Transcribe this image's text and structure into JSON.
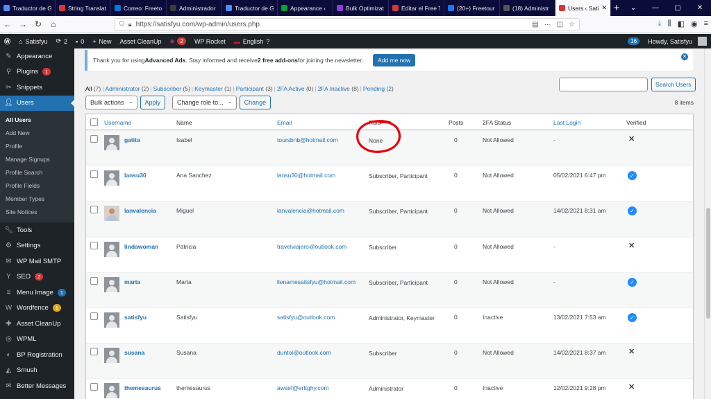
{
  "browser": {
    "tabs": [
      {
        "label": "Traductor de G",
        "color": "#4f8df5",
        "active": false
      },
      {
        "label": "String Translat",
        "color": "#d63638",
        "active": false
      },
      {
        "label": "Correo: Freeto",
        "color": "#0078d4",
        "active": false
      },
      {
        "label": "Administrador",
        "color": "#3c3c3c",
        "active": false
      },
      {
        "label": "Traductor de G",
        "color": "#4f8df5",
        "active": false
      },
      {
        "label": "Appearance ‹",
        "color": "#00a32a",
        "active": false
      },
      {
        "label": "Bulk Optimizat",
        "color": "#8f3cd6",
        "active": false
      },
      {
        "label": "Editar el Free T",
        "color": "#d63638",
        "active": false
      },
      {
        "label": "(20+) Freetour",
        "color": "#1877f2",
        "active": false
      },
      {
        "label": "(18) Administr",
        "color": "#555555",
        "active": false
      },
      {
        "label": "Users ‹ Sati",
        "color": "#d63638",
        "active": true
      }
    ],
    "url": "https://satisfyu.com/wp-admin/users.php"
  },
  "adminbar": {
    "site": "Satisfyu",
    "updates": "2",
    "comments": "0",
    "new": "New",
    "asset_cleanup": "Asset CleanUp",
    "notifications": "2",
    "wp_rocket": "WP Rocket",
    "language": "English",
    "count": "16",
    "howdy": "Howdy, Satisfyu"
  },
  "sidebar": {
    "top_items": [
      {
        "label": "Appearance",
        "icon": "appearance-icon"
      },
      {
        "label": "Plugins",
        "icon": "plugins-icon",
        "badge": "1"
      },
      {
        "label": "Snippets",
        "icon": "snippets-icon"
      },
      {
        "label": "Users",
        "icon": "users-icon",
        "current": true
      }
    ],
    "submenu": [
      "All Users",
      "Add New",
      "Profile",
      "Manage Signups",
      "Profile Search",
      "Profile Fields",
      "Member Types",
      "Site Notices"
    ],
    "bottom_items": [
      {
        "label": "Tools",
        "icon": "tools-icon"
      },
      {
        "label": "Settings",
        "icon": "settings-icon"
      },
      {
        "label": "WP Mail SMTP",
        "icon": "mail-icon"
      },
      {
        "label": "SEO",
        "icon": "seo-icon",
        "badge": "2",
        "badge_color": "#d63638"
      },
      {
        "label": "Menu Image",
        "icon": "menu-image-icon",
        "badge": "1",
        "badge_color": "#2271b1"
      },
      {
        "label": "Wordfence",
        "icon": "wordfence-icon",
        "badge": "1",
        "badge_color": "#dba617"
      },
      {
        "label": "Asset CleanUp",
        "icon": "asset-cleanup-icon"
      },
      {
        "label": "WPML",
        "icon": "wpml-icon"
      },
      {
        "label": "BP Registration",
        "icon": "bp-registration-icon"
      },
      {
        "label": "Smush",
        "icon": "smush-icon"
      },
      {
        "label": "Better Messages",
        "icon": "better-messages-icon"
      }
    ]
  },
  "notice": {
    "text_before": "Thank you for using ",
    "brand": "Advanced Ads",
    "text_middle": ". Stay informed and receive ",
    "highlight": "2 free add-ons",
    "text_after": " for joining the newsletter.",
    "button": "Add me now"
  },
  "filters": [
    {
      "label": "All",
      "count": "(7)",
      "current": true
    },
    {
      "label": "Administrator",
      "count": "(2)"
    },
    {
      "label": "Subscriber",
      "count": "(5)"
    },
    {
      "label": "Keymaster",
      "count": "(1)"
    },
    {
      "label": "Participant",
      "count": "(3)"
    },
    {
      "label": "2FA Active",
      "count": "(0)"
    },
    {
      "label": "2FA Inactive",
      "count": "(8)"
    },
    {
      "label": "Pending",
      "count": "(2)"
    }
  ],
  "search_button": "Search Users",
  "bulk_actions": "Bulk actions",
  "apply": "Apply",
  "change_role": "Change role to...",
  "change": "Change",
  "item_count": "8 items",
  "columns": {
    "username": "Username",
    "name": "Name",
    "email": "Email",
    "role": "Role",
    "posts": "Posts",
    "twofa": "2FA Status",
    "last_login": "Last Login",
    "verified": "Verified"
  },
  "users": [
    {
      "username": "gatita",
      "name": "Isabel",
      "email": "toursbnb@hotmail.com",
      "role": "None",
      "posts": "0",
      "twofa": "Not Allowed",
      "last_login": "-",
      "verified": false,
      "avatar": "default"
    },
    {
      "username": "lansu30",
      "name": "Ana Sanchez",
      "email": "lansu30@hotmail.com",
      "role": "Subscriber, Participant",
      "posts": "0",
      "twofa": "Not Allowed",
      "last_login": "05/02/2021 6:47 pm",
      "verified": true,
      "avatar": "default"
    },
    {
      "username": "lanvalencia",
      "name": "Miguel",
      "email": "lanvalencia@hotmail.com",
      "role": "Subscriber, Participant",
      "posts": "0",
      "twofa": "Not Allowed",
      "last_login": "14/02/2021 8:31 am",
      "verified": true,
      "avatar": "photo"
    },
    {
      "username": "lindawoman",
      "name": "Patricia",
      "email": "travelviajero@outlook.com",
      "role": "Subscriber",
      "posts": "0",
      "twofa": "Not Allowed",
      "last_login": "-",
      "verified": false,
      "avatar": "default"
    },
    {
      "username": "marta",
      "name": "Marta",
      "email": "llenamesatisfyu@hotmail.com",
      "role": "Subscriber, Participant",
      "posts": "0",
      "twofa": "Not Allowed",
      "last_login": "-",
      "verified": true,
      "avatar": "default"
    },
    {
      "username": "satisfyu",
      "name": "Satisfyu",
      "email": "satisfyu@outlook.com",
      "role": "Administrator, Keymaster",
      "posts": "0",
      "twofa": "Inactive",
      "last_login": "13/02/2021 7:53 am",
      "verified": true,
      "avatar": "default"
    },
    {
      "username": "susana",
      "name": "Susana",
      "email": "duntol@outlook.com",
      "role": "Subscriber",
      "posts": "0",
      "twofa": "Not Allowed",
      "last_login": "14/02/2021 8:37 am",
      "verified": false,
      "avatar": "default"
    },
    {
      "username": "themesaurus",
      "name": "themesaurus",
      "email": "awsef@erttghy.com",
      "role": "Administrator",
      "posts": "0",
      "twofa": "Inactive",
      "last_login": "12/02/2021 9:28 pm",
      "verified": false,
      "avatar": "default"
    }
  ],
  "colors": {
    "accent": "#2271b1",
    "admin_dark": "#1d2327",
    "annotation": "#e8000a",
    "verified": "#1e8cff"
  }
}
